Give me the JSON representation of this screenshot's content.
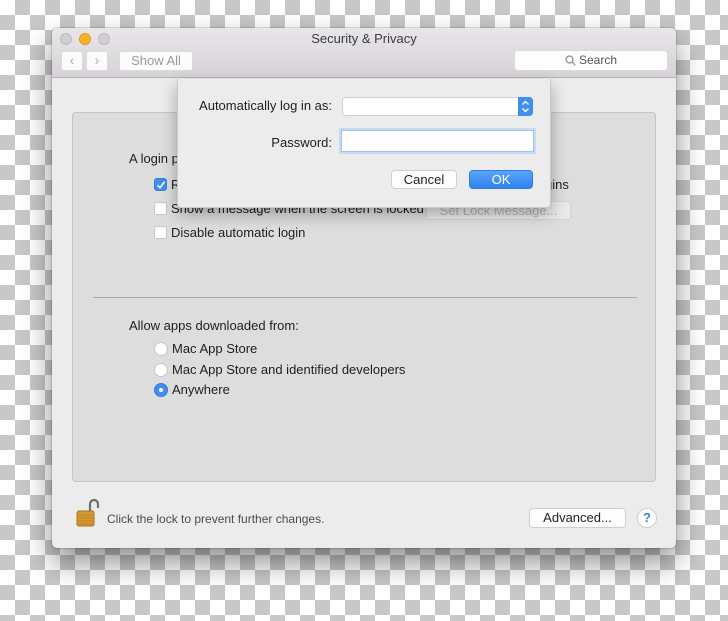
{
  "window": {
    "title": "Security & Privacy",
    "toolbar": {
      "back_icon": "chevron-left",
      "forward_icon": "chevron-right",
      "show_all_label": "Show All",
      "search_placeholder": "Search"
    }
  },
  "general": {
    "login_prefix": "A login p",
    "require_password_prefix": "R",
    "require_password_suffix": "gins",
    "require_password_checked": true,
    "show_message_label": "Show a message when the screen is locked",
    "show_message_checked": false,
    "set_lock_message_label": "Set Lock Message...",
    "disable_auto_login_label": "Disable automatic login",
    "disable_auto_login_checked": false
  },
  "gatekeeper": {
    "heading": "Allow apps downloaded from:",
    "options": [
      {
        "label": "Mac App Store",
        "selected": false
      },
      {
        "label": "Mac App Store and identified developers",
        "selected": false
      },
      {
        "label": "Anywhere",
        "selected": true
      }
    ]
  },
  "footer": {
    "lock_message": "Click the lock to prevent further changes.",
    "lock_state": "unlocked",
    "advanced_label": "Advanced...",
    "help_label": "?"
  },
  "sheet": {
    "auto_login_label": "Automatically log in as:",
    "auto_login_value": "",
    "password_label": "Password:",
    "password_value": "",
    "cancel_label": "Cancel",
    "ok_label": "OK"
  },
  "colors": {
    "accent": "#3f8ef0",
    "minimize": "#f5b428"
  }
}
